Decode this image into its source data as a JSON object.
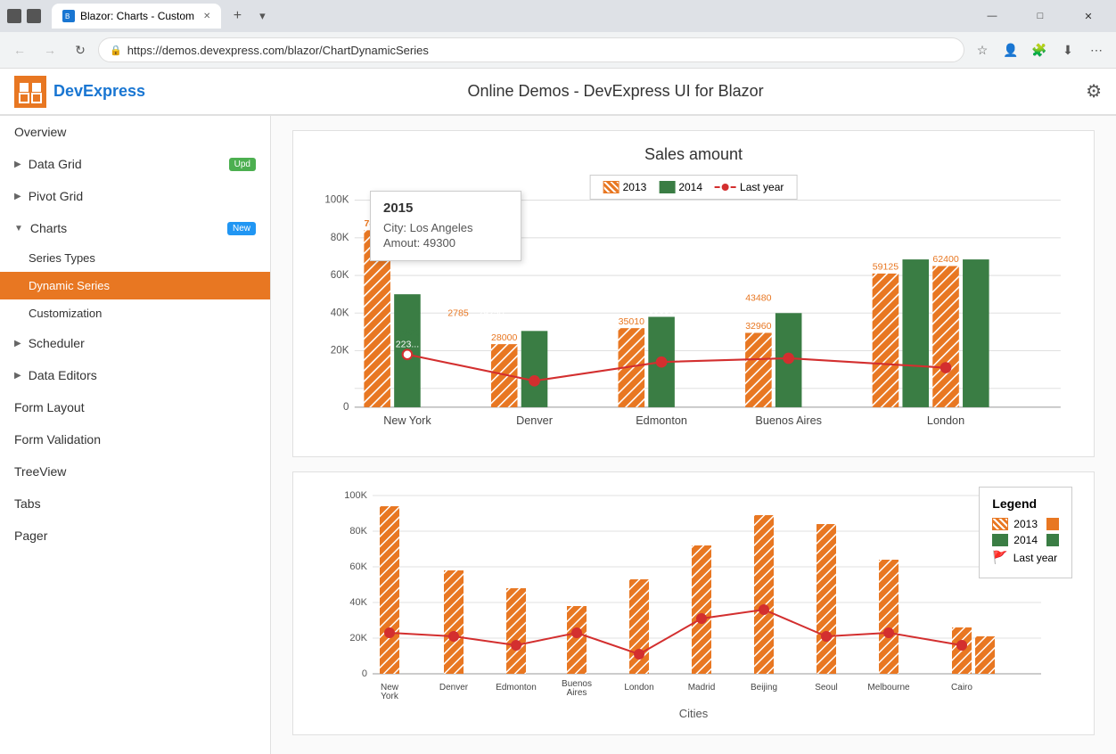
{
  "browser": {
    "tab_title": "Blazor: Charts - Custom",
    "url": "https://demos.devexpress.com/blazor/ChartDynamicSeries",
    "favicon": "B"
  },
  "header": {
    "brand": "DevExpress",
    "title": "Online Demos - DevExpress UI for Blazor"
  },
  "sidebar": {
    "items": [
      {
        "id": "overview",
        "label": "Overview",
        "indent": false,
        "badge": null
      },
      {
        "id": "data-grid",
        "label": "Data Grid",
        "indent": false,
        "badge": "Upd",
        "badge_class": "badge-upd"
      },
      {
        "id": "pivot-grid",
        "label": "Pivot Grid",
        "indent": false,
        "badge": null
      },
      {
        "id": "charts",
        "label": "Charts",
        "indent": false,
        "badge": "New",
        "badge_class": "badge-new",
        "expanded": true
      },
      {
        "id": "series-types",
        "label": "Series Types",
        "indent": true,
        "badge": null
      },
      {
        "id": "dynamic-series",
        "label": "Dynamic Series",
        "indent": true,
        "badge": null,
        "active": true
      },
      {
        "id": "customization",
        "label": "Customization",
        "indent": true,
        "badge": null
      },
      {
        "id": "scheduler",
        "label": "Scheduler",
        "indent": false,
        "badge": null
      },
      {
        "id": "data-editors",
        "label": "Data Editors",
        "indent": false,
        "badge": null
      },
      {
        "id": "form-layout",
        "label": "Form Layout",
        "indent": false,
        "badge": null
      },
      {
        "id": "form-validation",
        "label": "Form Validation",
        "indent": false,
        "badge": null
      },
      {
        "id": "treeview",
        "label": "TreeView",
        "indent": false,
        "badge": null
      },
      {
        "id": "tabs",
        "label": "Tabs",
        "indent": false,
        "badge": null
      },
      {
        "id": "pager",
        "label": "Pager",
        "indent": false,
        "badge": null
      }
    ]
  },
  "chart1": {
    "title": "Sales amount",
    "legend": {
      "items": [
        "2013",
        "2014",
        "Last year"
      ]
    },
    "tooltip": {
      "year": "2015",
      "city_label": "City: Los Angeles",
      "amount_label": "Amout: 49300"
    },
    "cities": [
      "New York",
      "Denver",
      "Edmonton",
      "Buenos Aires",
      "London"
    ],
    "y_labels": [
      "100K",
      "80K",
      "60K",
      "40K",
      "20K",
      "0"
    ],
    "bars": [
      {
        "city": "New York",
        "val2013": 78270,
        "val2014": 50000,
        "lastYear": 23000
      },
      {
        "city": "Denver",
        "val2013": 28000,
        "val2014": 34080,
        "lastYear": 12000
      },
      {
        "city": "Edmonton",
        "val2013": 35010,
        "val2014": 39855,
        "lastYear": 18000
      },
      {
        "city": "Buenos Aires",
        "val2013": 32960,
        "val2014": 41700,
        "lastYear": 20000
      },
      {
        "city": "London",
        "val2013": 59125,
        "val2014": 65250,
        "lastYear": 17000
      }
    ]
  },
  "chart2": {
    "legend": {
      "title": "Legend",
      "items": [
        "2013",
        "2014",
        "Last year"
      ]
    },
    "cities": [
      "New York",
      "Denver",
      "Edmonton",
      "Buenos Aires",
      "London",
      "Madrid",
      "Beijing",
      "Seoul",
      "Melbourne",
      "Cairo"
    ],
    "x_axis_title": "Cities",
    "y_labels": [
      "100K",
      "80K",
      "60K",
      "40K",
      "20K",
      "0"
    ]
  }
}
